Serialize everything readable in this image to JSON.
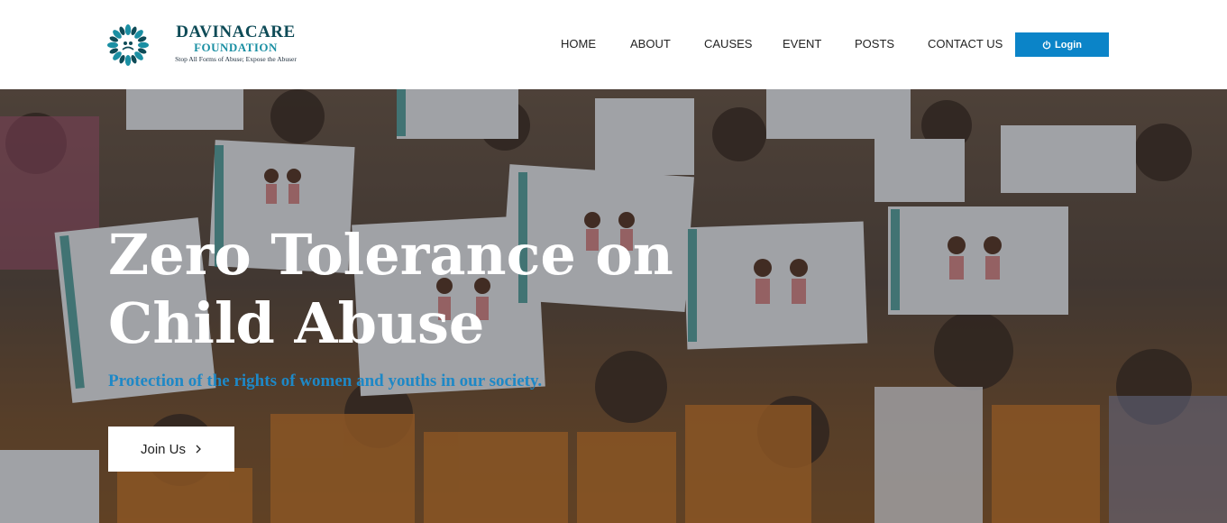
{
  "brand": {
    "name": "DAVINACARE",
    "sub": "FOUNDATION",
    "tagline": "Stop All Forms of Abuse; Expose the Abuser",
    "logo_icon": "foundation-logo-icon",
    "colors": {
      "primary": "#0e4b57",
      "accent": "#1a8fa3"
    }
  },
  "nav": {
    "items": [
      {
        "label": "HOME"
      },
      {
        "label": "ABOUT"
      },
      {
        "label": "CAUSES"
      },
      {
        "label": "EVENT"
      },
      {
        "label": "POSTS"
      },
      {
        "label": "CONTACT US"
      }
    ],
    "login": {
      "label": "Login",
      "icon": "power-icon",
      "color": "#0b84c8"
    }
  },
  "hero": {
    "title": "Zero Tolerance on\nChild  Abuse",
    "subtitle": "Protection of the rights of women and youths in our society.",
    "subtitle_color": "#1e88c6",
    "cta": {
      "label": "Join Us",
      "icon": "chevron-right-icon"
    }
  }
}
